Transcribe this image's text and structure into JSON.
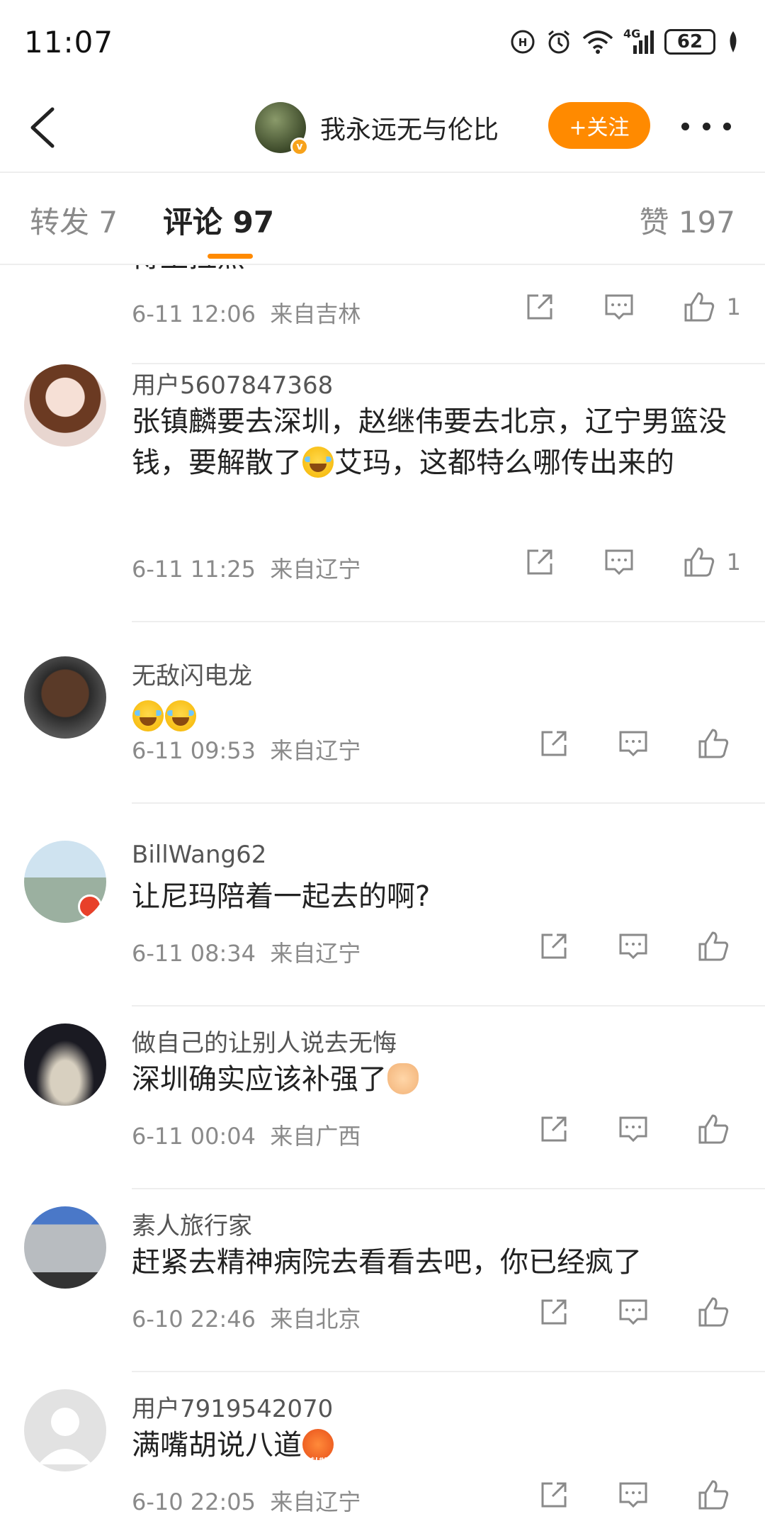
{
  "status_bar": {
    "time": "11:07",
    "battery": "62",
    "network": "4G"
  },
  "header": {
    "author_name": "我永远无与伦比",
    "verify_badge": "v",
    "follow_label": "+关注"
  },
  "tabs": {
    "repost": "转发 7",
    "comments": "评论 97",
    "likes": "赞 197"
  },
  "comments": [
    {
      "username": "",
      "text": "博王拉黑",
      "time": "6-11 12:06",
      "location": "来自吉林",
      "likes": "1"
    },
    {
      "username": "用户5607847368",
      "text_before_emoji": "张镇麟要去深圳，赵继伟要去北京，辽宁男篮没钱，要解散了",
      "text_after_emoji": "艾玛，这都特么哪传出来的",
      "time": "6-11 11:25",
      "location": "来自辽宁",
      "likes": "1"
    },
    {
      "username": "无敌闪电龙",
      "time": "6-11 09:53",
      "location": "来自辽宁",
      "likes": ""
    },
    {
      "username": "BillWang62",
      "text": "让尼玛陪着一起去的啊?",
      "time": "6-11 08:34",
      "location": "来自辽宁",
      "likes": ""
    },
    {
      "username": "做自己的让别人说去无悔",
      "text": "深圳确实应该补强了",
      "time": "6-11 00:04",
      "location": "来自广西",
      "likes": ""
    },
    {
      "username": "素人旅行家",
      "text": "赶紧去精神病院去看看去吧，你已经疯了",
      "time": "6-10 22:46",
      "location": "来自北京",
      "likes": ""
    },
    {
      "username": "用户7919542070",
      "text": "满嘴胡说八道",
      "time": "6-10 22:05",
      "location": "来自辽宁",
      "likes": ""
    }
  ],
  "colors": {
    "accent": "#ff8a00",
    "text_primary": "#222222",
    "text_secondary": "#8a8a8a"
  }
}
